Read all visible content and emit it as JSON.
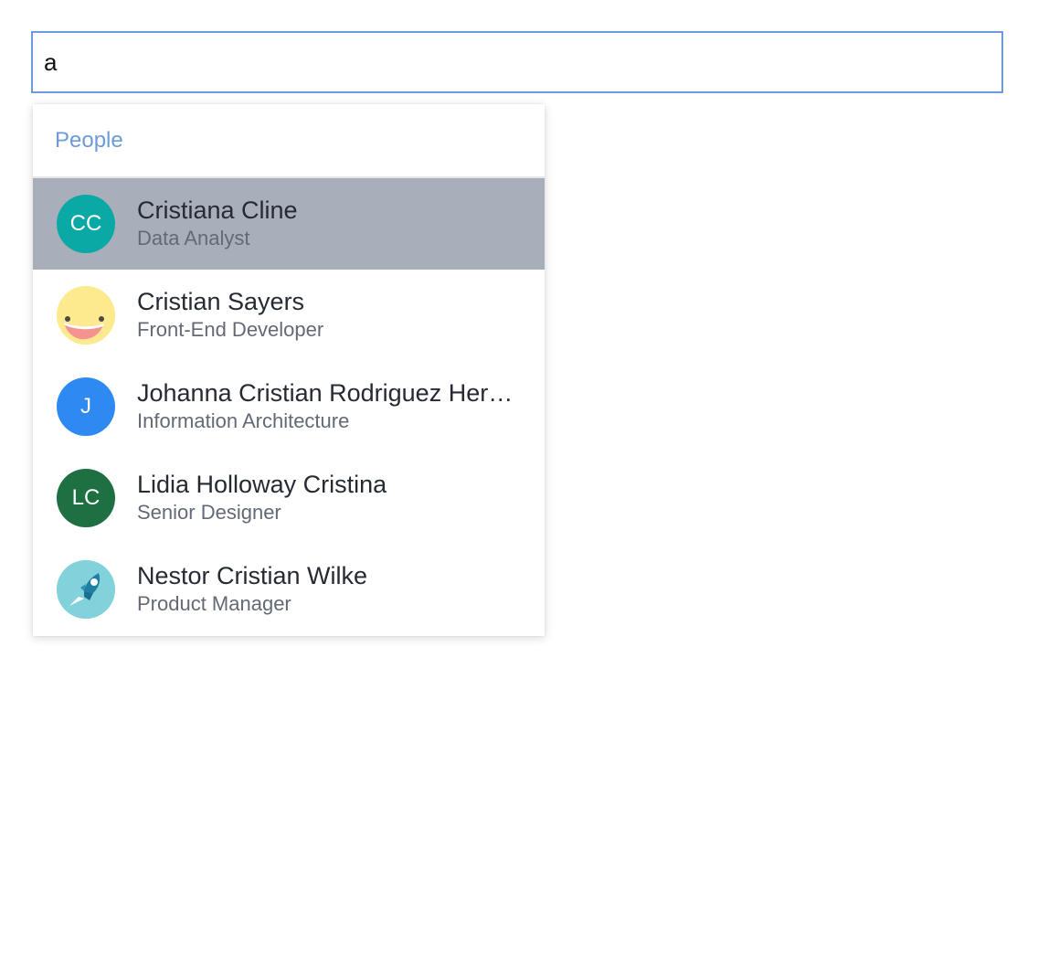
{
  "search": {
    "value": "a"
  },
  "dropdown": {
    "section_label": "People",
    "people": [
      {
        "name": "Cristiana Cline",
        "role": "Data Analyst",
        "initials": "CC",
        "avatar_color": "#0aa9a5",
        "avatar_type": "initials",
        "selected": true
      },
      {
        "name": "Cristian Sayers",
        "role": "Front-End Developer",
        "avatar_type": "smiley-face-icon",
        "selected": false
      },
      {
        "name": "Johanna Cristian Rodriguez Hern…",
        "role": "Information Architecture",
        "initials": "J",
        "avatar_color": "#2e8af0",
        "avatar_type": "initials",
        "selected": false
      },
      {
        "name": "Lidia Holloway Cristina",
        "role": "Senior Designer",
        "initials": "LC",
        "avatar_color": "#1e6f42",
        "avatar_type": "initials",
        "selected": false
      },
      {
        "name": "Nestor Cristian Wilke",
        "role": "Product Manager",
        "avatar_type": "rocket-icon",
        "selected": false
      }
    ]
  },
  "colors": {
    "accent": "#6b9bd8",
    "selected_row": "#a8afbb"
  }
}
